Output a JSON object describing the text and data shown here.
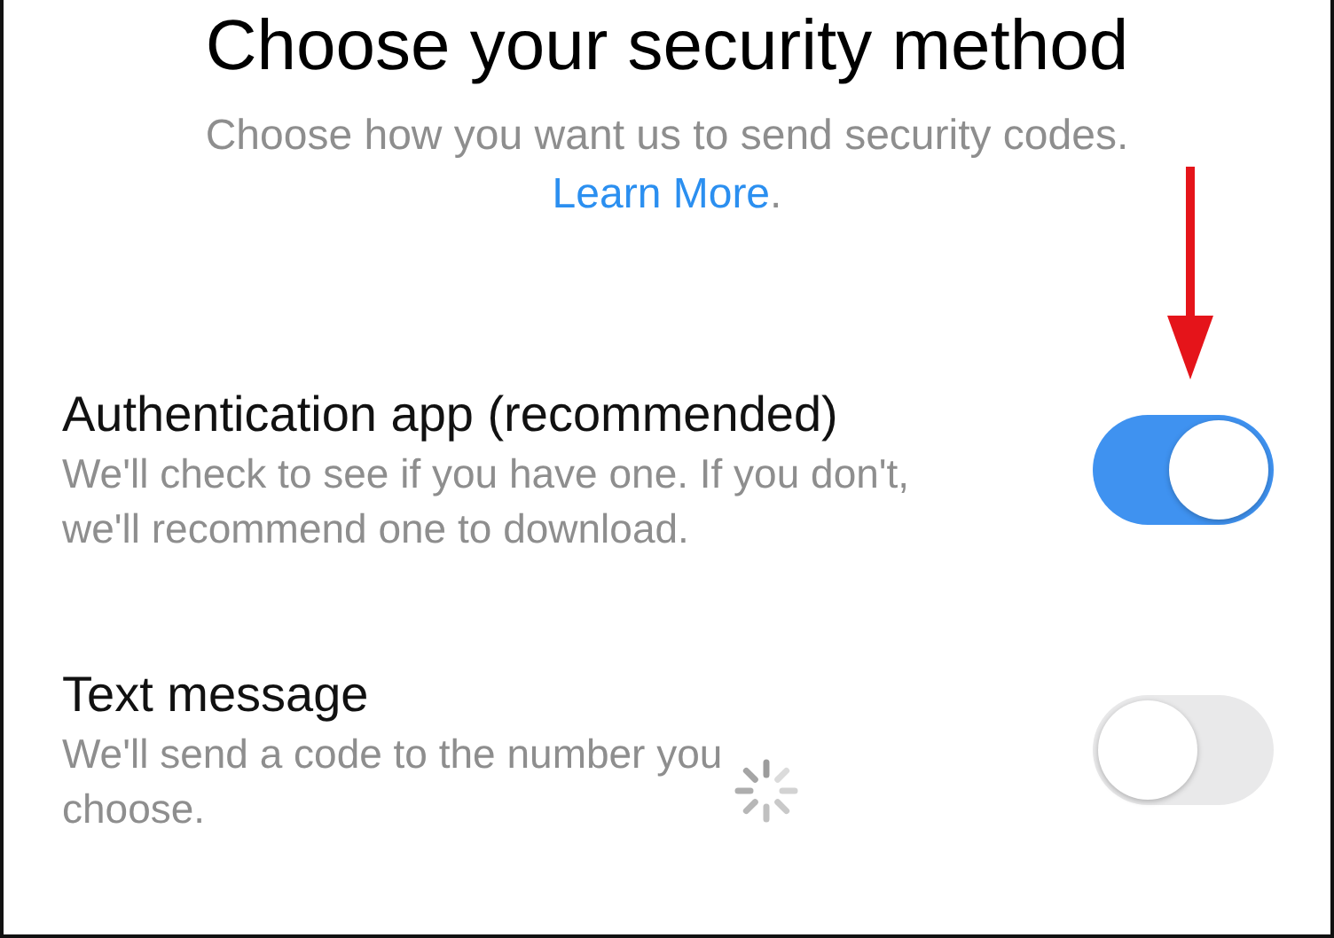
{
  "title": "Choose your security method",
  "subtitle": "Choose how you want us to send security codes.",
  "learn_more_link": "Learn More",
  "subtitle_end": ".",
  "options": [
    {
      "label": "Authentication app (recommended)",
      "description": "We'll check to see if you have one. If you don't, we'll recommend one to download.",
      "on": true,
      "arrow": true,
      "loading": false
    },
    {
      "label": "Text message",
      "description": "We'll send a code to the number you choose.",
      "on": false,
      "arrow": false,
      "loading": true
    }
  ]
}
